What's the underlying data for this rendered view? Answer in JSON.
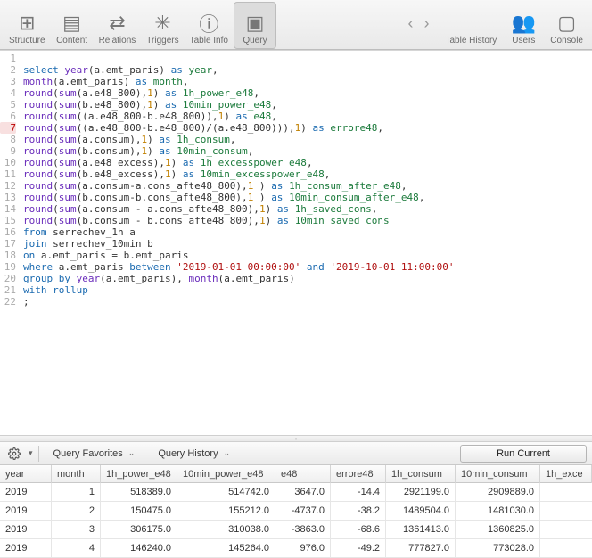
{
  "toolbar": {
    "left": [
      {
        "name": "structure",
        "label": "Structure",
        "icon": "⊞"
      },
      {
        "name": "content",
        "label": "Content",
        "icon": "▤"
      },
      {
        "name": "relations",
        "label": "Relations",
        "icon": "⇄"
      },
      {
        "name": "triggers",
        "label": "Triggers",
        "icon": "✳"
      },
      {
        "name": "table-info",
        "label": "Table Info",
        "icon": "ⓘ"
      },
      {
        "name": "query",
        "label": "Query",
        "icon": "▣",
        "active": true
      }
    ],
    "right": [
      {
        "name": "table-history",
        "label": "Table History",
        "icon": ""
      },
      {
        "name": "users",
        "label": "Users",
        "icon": "👥"
      },
      {
        "name": "console",
        "label": "Console",
        "icon": "▢"
      }
    ]
  },
  "editor": {
    "lines": [
      "",
      "<span class='kw'>select</span> <span class='fn'>year</span>(a.emt_paris) <span class='kw'>as</span> <span class='id'>year</span>,",
      "<span class='fn'>month</span>(a.emt_paris) <span class='kw'>as</span> <span class='id'>month</span>,",
      "<span class='fn'>round</span>(<span class='fn'>sum</span>(a.e48_800),<span class='num'>1</span>) <span class='kw'>as</span> <span class='id'>1h_power_e48</span>,",
      "<span class='fn'>round</span>(<span class='fn'>sum</span>(b.e48_800),<span class='num'>1</span>) <span class='kw'>as</span> <span class='id'>10min_power_e48</span>,",
      "<span class='fn'>round</span>(<span class='fn'>sum</span>((a.e48_800-b.e48_800)),<span class='num'>1</span>) <span class='kw'>as</span> <span class='id'>e48</span>,",
      "<span class='fn'>round</span>(<span class='fn'>sum</span>((a.e48_800-b.e48_800)/(a.e48_800))),<span class='num'>1</span>) <span class='kw'>as</span> <span class='id'>errore48</span>,",
      "<span class='fn'>round</span>(<span class='fn'>sum</span>(a.consum),<span class='num'>1</span>) <span class='kw'>as</span> <span class='id'>1h_consum</span>,",
      "<span class='fn'>round</span>(<span class='fn'>sum</span>(b.consum),<span class='num'>1</span>) <span class='kw'>as</span> <span class='id'>10min_consum</span>,",
      "<span class='fn'>round</span>(<span class='fn'>sum</span>(a.e48_excess),<span class='num'>1</span>) <span class='kw'>as</span> <span class='id'>1h_excesspower_e48</span>,",
      "<span class='fn'>round</span>(<span class='fn'>sum</span>(b.e48_excess),<span class='num'>1</span>) <span class='kw'>as</span> <span class='id'>10min_excesspower_e48</span>,",
      "<span class='fn'>round</span>(<span class='fn'>sum</span>(a.consum-a.cons_afte48_800),<span class='num'>1</span> ) <span class='kw'>as</span> <span class='id'>1h_consum_after_e48</span>,",
      "<span class='fn'>round</span>(<span class='fn'>sum</span>(b.consum-b.cons_afte48_800),<span class='num'>1</span> ) <span class='kw'>as</span> <span class='id'>10min_consum_after_e48</span>,",
      "<span class='fn'>round</span>(<span class='fn'>sum</span>(a.consum - a.cons_afte48_800),<span class='num'>1</span>) <span class='kw'>as</span> <span class='id'>1h_saved_cons</span>,",
      "<span class='fn'>round</span>(<span class='fn'>sum</span>(b.consum - b.cons_afte48_800),<span class='num'>1</span>) <span class='kw'>as</span> <span class='id'>10min_saved_cons</span>",
      "<span class='kw'>from</span> serrechev_1h a",
      "<span class='kw'>join</span> serrechev_10min b",
      "<span class='kw'>on</span> a.emt_paris = b.emt_paris",
      "<span class='kw'>where</span> a.emt_paris <span class='kw'>between</span> <span class='str'>'2019-01-01 00:00:00'</span> <span class='kw'>and</span> <span class='str'>'2019-10-01 11:00:00'</span>",
      "<span class='kw'>group</span> <span class='kw'>by</span> <span class='fn'>year</span>(a.emt_paris), <span class='fn'>month</span>(a.emt_paris)",
      "<span class='kw'>with rollup</span>",
      ";"
    ],
    "errorLines": [
      7
    ]
  },
  "actions": {
    "favorites": "Query Favorites",
    "history": "Query History",
    "run": "Run Current"
  },
  "grid": {
    "columns": [
      "year",
      "month",
      "1h_power_e48",
      "10min_power_e48",
      "e48",
      "errore48",
      "1h_consum",
      "10min_consum",
      "1h_exce"
    ],
    "rows": [
      [
        "2019",
        "1",
        "518389.0",
        "514742.0",
        "3647.0",
        "-14.4",
        "2921199.0",
        "2909889.0"
      ],
      [
        "2019",
        "2",
        "150475.0",
        "155212.0",
        "-4737.0",
        "-38.2",
        "1489504.0",
        "1481030.0"
      ],
      [
        "2019",
        "3",
        "306175.0",
        "310038.0",
        "-3863.0",
        "-68.6",
        "1361413.0",
        "1360825.0"
      ],
      [
        "2019",
        "4",
        "146240.0",
        "145264.0",
        "976.0",
        "-49.2",
        "777827.0",
        "773028.0"
      ]
    ]
  }
}
